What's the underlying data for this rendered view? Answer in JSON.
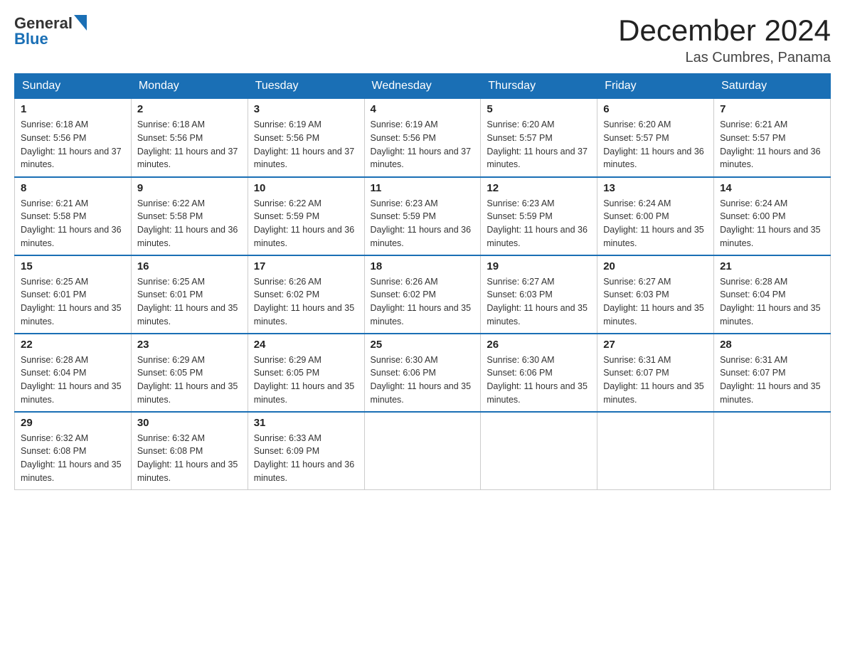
{
  "header": {
    "logo_general": "General",
    "logo_blue": "Blue",
    "month_year": "December 2024",
    "location": "Las Cumbres, Panama"
  },
  "weekdays": [
    "Sunday",
    "Monday",
    "Tuesday",
    "Wednesday",
    "Thursday",
    "Friday",
    "Saturday"
  ],
  "weeks": [
    [
      {
        "day": 1,
        "sunrise": "6:18 AM",
        "sunset": "5:56 PM",
        "daylight": "11 hours and 37 minutes."
      },
      {
        "day": 2,
        "sunrise": "6:18 AM",
        "sunset": "5:56 PM",
        "daylight": "11 hours and 37 minutes."
      },
      {
        "day": 3,
        "sunrise": "6:19 AM",
        "sunset": "5:56 PM",
        "daylight": "11 hours and 37 minutes."
      },
      {
        "day": 4,
        "sunrise": "6:19 AM",
        "sunset": "5:56 PM",
        "daylight": "11 hours and 37 minutes."
      },
      {
        "day": 5,
        "sunrise": "6:20 AM",
        "sunset": "5:57 PM",
        "daylight": "11 hours and 37 minutes."
      },
      {
        "day": 6,
        "sunrise": "6:20 AM",
        "sunset": "5:57 PM",
        "daylight": "11 hours and 36 minutes."
      },
      {
        "day": 7,
        "sunrise": "6:21 AM",
        "sunset": "5:57 PM",
        "daylight": "11 hours and 36 minutes."
      }
    ],
    [
      {
        "day": 8,
        "sunrise": "6:21 AM",
        "sunset": "5:58 PM",
        "daylight": "11 hours and 36 minutes."
      },
      {
        "day": 9,
        "sunrise": "6:22 AM",
        "sunset": "5:58 PM",
        "daylight": "11 hours and 36 minutes."
      },
      {
        "day": 10,
        "sunrise": "6:22 AM",
        "sunset": "5:59 PM",
        "daylight": "11 hours and 36 minutes."
      },
      {
        "day": 11,
        "sunrise": "6:23 AM",
        "sunset": "5:59 PM",
        "daylight": "11 hours and 36 minutes."
      },
      {
        "day": 12,
        "sunrise": "6:23 AM",
        "sunset": "5:59 PM",
        "daylight": "11 hours and 36 minutes."
      },
      {
        "day": 13,
        "sunrise": "6:24 AM",
        "sunset": "6:00 PM",
        "daylight": "11 hours and 35 minutes."
      },
      {
        "day": 14,
        "sunrise": "6:24 AM",
        "sunset": "6:00 PM",
        "daylight": "11 hours and 35 minutes."
      }
    ],
    [
      {
        "day": 15,
        "sunrise": "6:25 AM",
        "sunset": "6:01 PM",
        "daylight": "11 hours and 35 minutes."
      },
      {
        "day": 16,
        "sunrise": "6:25 AM",
        "sunset": "6:01 PM",
        "daylight": "11 hours and 35 minutes."
      },
      {
        "day": 17,
        "sunrise": "6:26 AM",
        "sunset": "6:02 PM",
        "daylight": "11 hours and 35 minutes."
      },
      {
        "day": 18,
        "sunrise": "6:26 AM",
        "sunset": "6:02 PM",
        "daylight": "11 hours and 35 minutes."
      },
      {
        "day": 19,
        "sunrise": "6:27 AM",
        "sunset": "6:03 PM",
        "daylight": "11 hours and 35 minutes."
      },
      {
        "day": 20,
        "sunrise": "6:27 AM",
        "sunset": "6:03 PM",
        "daylight": "11 hours and 35 minutes."
      },
      {
        "day": 21,
        "sunrise": "6:28 AM",
        "sunset": "6:04 PM",
        "daylight": "11 hours and 35 minutes."
      }
    ],
    [
      {
        "day": 22,
        "sunrise": "6:28 AM",
        "sunset": "6:04 PM",
        "daylight": "11 hours and 35 minutes."
      },
      {
        "day": 23,
        "sunrise": "6:29 AM",
        "sunset": "6:05 PM",
        "daylight": "11 hours and 35 minutes."
      },
      {
        "day": 24,
        "sunrise": "6:29 AM",
        "sunset": "6:05 PM",
        "daylight": "11 hours and 35 minutes."
      },
      {
        "day": 25,
        "sunrise": "6:30 AM",
        "sunset": "6:06 PM",
        "daylight": "11 hours and 35 minutes."
      },
      {
        "day": 26,
        "sunrise": "6:30 AM",
        "sunset": "6:06 PM",
        "daylight": "11 hours and 35 minutes."
      },
      {
        "day": 27,
        "sunrise": "6:31 AM",
        "sunset": "6:07 PM",
        "daylight": "11 hours and 35 minutes."
      },
      {
        "day": 28,
        "sunrise": "6:31 AM",
        "sunset": "6:07 PM",
        "daylight": "11 hours and 35 minutes."
      }
    ],
    [
      {
        "day": 29,
        "sunrise": "6:32 AM",
        "sunset": "6:08 PM",
        "daylight": "11 hours and 35 minutes."
      },
      {
        "day": 30,
        "sunrise": "6:32 AM",
        "sunset": "6:08 PM",
        "daylight": "11 hours and 35 minutes."
      },
      {
        "day": 31,
        "sunrise": "6:33 AM",
        "sunset": "6:09 PM",
        "daylight": "11 hours and 36 minutes."
      },
      null,
      null,
      null,
      null
    ]
  ]
}
